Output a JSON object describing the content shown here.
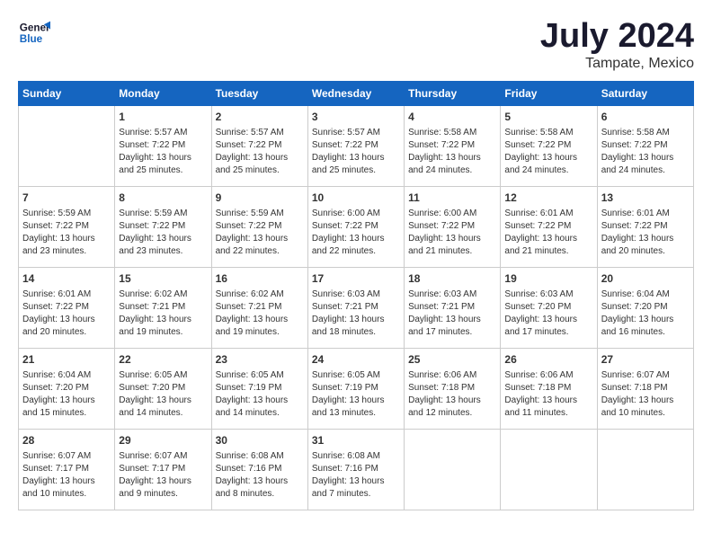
{
  "header": {
    "logo_line1": "General",
    "logo_line2": "Blue",
    "month_year": "July 2024",
    "location": "Tampate, Mexico"
  },
  "columns": [
    "Sunday",
    "Monday",
    "Tuesday",
    "Wednesday",
    "Thursday",
    "Friday",
    "Saturday"
  ],
  "weeks": [
    [
      {
        "day": "",
        "info": ""
      },
      {
        "day": "1",
        "info": "Sunrise: 5:57 AM\nSunset: 7:22 PM\nDaylight: 13 hours\nand 25 minutes."
      },
      {
        "day": "2",
        "info": "Sunrise: 5:57 AM\nSunset: 7:22 PM\nDaylight: 13 hours\nand 25 minutes."
      },
      {
        "day": "3",
        "info": "Sunrise: 5:57 AM\nSunset: 7:22 PM\nDaylight: 13 hours\nand 25 minutes."
      },
      {
        "day": "4",
        "info": "Sunrise: 5:58 AM\nSunset: 7:22 PM\nDaylight: 13 hours\nand 24 minutes."
      },
      {
        "day": "5",
        "info": "Sunrise: 5:58 AM\nSunset: 7:22 PM\nDaylight: 13 hours\nand 24 minutes."
      },
      {
        "day": "6",
        "info": "Sunrise: 5:58 AM\nSunset: 7:22 PM\nDaylight: 13 hours\nand 24 minutes."
      }
    ],
    [
      {
        "day": "7",
        "info": "Sunrise: 5:59 AM\nSunset: 7:22 PM\nDaylight: 13 hours\nand 23 minutes."
      },
      {
        "day": "8",
        "info": "Sunrise: 5:59 AM\nSunset: 7:22 PM\nDaylight: 13 hours\nand 23 minutes."
      },
      {
        "day": "9",
        "info": "Sunrise: 5:59 AM\nSunset: 7:22 PM\nDaylight: 13 hours\nand 22 minutes."
      },
      {
        "day": "10",
        "info": "Sunrise: 6:00 AM\nSunset: 7:22 PM\nDaylight: 13 hours\nand 22 minutes."
      },
      {
        "day": "11",
        "info": "Sunrise: 6:00 AM\nSunset: 7:22 PM\nDaylight: 13 hours\nand 21 minutes."
      },
      {
        "day": "12",
        "info": "Sunrise: 6:01 AM\nSunset: 7:22 PM\nDaylight: 13 hours\nand 21 minutes."
      },
      {
        "day": "13",
        "info": "Sunrise: 6:01 AM\nSunset: 7:22 PM\nDaylight: 13 hours\nand 20 minutes."
      }
    ],
    [
      {
        "day": "14",
        "info": "Sunrise: 6:01 AM\nSunset: 7:22 PM\nDaylight: 13 hours\nand 20 minutes."
      },
      {
        "day": "15",
        "info": "Sunrise: 6:02 AM\nSunset: 7:21 PM\nDaylight: 13 hours\nand 19 minutes."
      },
      {
        "day": "16",
        "info": "Sunrise: 6:02 AM\nSunset: 7:21 PM\nDaylight: 13 hours\nand 19 minutes."
      },
      {
        "day": "17",
        "info": "Sunrise: 6:03 AM\nSunset: 7:21 PM\nDaylight: 13 hours\nand 18 minutes."
      },
      {
        "day": "18",
        "info": "Sunrise: 6:03 AM\nSunset: 7:21 PM\nDaylight: 13 hours\nand 17 minutes."
      },
      {
        "day": "19",
        "info": "Sunrise: 6:03 AM\nSunset: 7:20 PM\nDaylight: 13 hours\nand 17 minutes."
      },
      {
        "day": "20",
        "info": "Sunrise: 6:04 AM\nSunset: 7:20 PM\nDaylight: 13 hours\nand 16 minutes."
      }
    ],
    [
      {
        "day": "21",
        "info": "Sunrise: 6:04 AM\nSunset: 7:20 PM\nDaylight: 13 hours\nand 15 minutes."
      },
      {
        "day": "22",
        "info": "Sunrise: 6:05 AM\nSunset: 7:20 PM\nDaylight: 13 hours\nand 14 minutes."
      },
      {
        "day": "23",
        "info": "Sunrise: 6:05 AM\nSunset: 7:19 PM\nDaylight: 13 hours\nand 14 minutes."
      },
      {
        "day": "24",
        "info": "Sunrise: 6:05 AM\nSunset: 7:19 PM\nDaylight: 13 hours\nand 13 minutes."
      },
      {
        "day": "25",
        "info": "Sunrise: 6:06 AM\nSunset: 7:18 PM\nDaylight: 13 hours\nand 12 minutes."
      },
      {
        "day": "26",
        "info": "Sunrise: 6:06 AM\nSunset: 7:18 PM\nDaylight: 13 hours\nand 11 minutes."
      },
      {
        "day": "27",
        "info": "Sunrise: 6:07 AM\nSunset: 7:18 PM\nDaylight: 13 hours\nand 10 minutes."
      }
    ],
    [
      {
        "day": "28",
        "info": "Sunrise: 6:07 AM\nSunset: 7:17 PM\nDaylight: 13 hours\nand 10 minutes."
      },
      {
        "day": "29",
        "info": "Sunrise: 6:07 AM\nSunset: 7:17 PM\nDaylight: 13 hours\nand 9 minutes."
      },
      {
        "day": "30",
        "info": "Sunrise: 6:08 AM\nSunset: 7:16 PM\nDaylight: 13 hours\nand 8 minutes."
      },
      {
        "day": "31",
        "info": "Sunrise: 6:08 AM\nSunset: 7:16 PM\nDaylight: 13 hours\nand 7 minutes."
      },
      {
        "day": "",
        "info": ""
      },
      {
        "day": "",
        "info": ""
      },
      {
        "day": "",
        "info": ""
      }
    ]
  ]
}
